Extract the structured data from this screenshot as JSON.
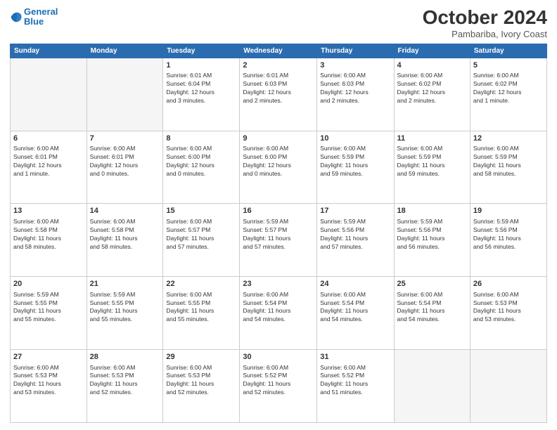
{
  "logo": {
    "line1": "General",
    "line2": "Blue"
  },
  "title": "October 2024",
  "location": "Pambariba, Ivory Coast",
  "weekdays": [
    "Sunday",
    "Monday",
    "Tuesday",
    "Wednesday",
    "Thursday",
    "Friday",
    "Saturday"
  ],
  "weeks": [
    [
      {
        "day": "",
        "info": ""
      },
      {
        "day": "",
        "info": ""
      },
      {
        "day": "1",
        "info": "Sunrise: 6:01 AM\nSunset: 6:04 PM\nDaylight: 12 hours\nand 3 minutes."
      },
      {
        "day": "2",
        "info": "Sunrise: 6:01 AM\nSunset: 6:03 PM\nDaylight: 12 hours\nand 2 minutes."
      },
      {
        "day": "3",
        "info": "Sunrise: 6:00 AM\nSunset: 6:03 PM\nDaylight: 12 hours\nand 2 minutes."
      },
      {
        "day": "4",
        "info": "Sunrise: 6:00 AM\nSunset: 6:02 PM\nDaylight: 12 hours\nand 2 minutes."
      },
      {
        "day": "5",
        "info": "Sunrise: 6:00 AM\nSunset: 6:02 PM\nDaylight: 12 hours\nand 1 minute."
      }
    ],
    [
      {
        "day": "6",
        "info": "Sunrise: 6:00 AM\nSunset: 6:01 PM\nDaylight: 12 hours\nand 1 minute."
      },
      {
        "day": "7",
        "info": "Sunrise: 6:00 AM\nSunset: 6:01 PM\nDaylight: 12 hours\nand 0 minutes."
      },
      {
        "day": "8",
        "info": "Sunrise: 6:00 AM\nSunset: 6:00 PM\nDaylight: 12 hours\nand 0 minutes."
      },
      {
        "day": "9",
        "info": "Sunrise: 6:00 AM\nSunset: 6:00 PM\nDaylight: 12 hours\nand 0 minutes."
      },
      {
        "day": "10",
        "info": "Sunrise: 6:00 AM\nSunset: 5:59 PM\nDaylight: 11 hours\nand 59 minutes."
      },
      {
        "day": "11",
        "info": "Sunrise: 6:00 AM\nSunset: 5:59 PM\nDaylight: 11 hours\nand 59 minutes."
      },
      {
        "day": "12",
        "info": "Sunrise: 6:00 AM\nSunset: 5:59 PM\nDaylight: 11 hours\nand 58 minutes."
      }
    ],
    [
      {
        "day": "13",
        "info": "Sunrise: 6:00 AM\nSunset: 5:58 PM\nDaylight: 11 hours\nand 58 minutes."
      },
      {
        "day": "14",
        "info": "Sunrise: 6:00 AM\nSunset: 5:58 PM\nDaylight: 11 hours\nand 58 minutes."
      },
      {
        "day": "15",
        "info": "Sunrise: 6:00 AM\nSunset: 5:57 PM\nDaylight: 11 hours\nand 57 minutes."
      },
      {
        "day": "16",
        "info": "Sunrise: 5:59 AM\nSunset: 5:57 PM\nDaylight: 11 hours\nand 57 minutes."
      },
      {
        "day": "17",
        "info": "Sunrise: 5:59 AM\nSunset: 5:56 PM\nDaylight: 11 hours\nand 57 minutes."
      },
      {
        "day": "18",
        "info": "Sunrise: 5:59 AM\nSunset: 5:56 PM\nDaylight: 11 hours\nand 56 minutes."
      },
      {
        "day": "19",
        "info": "Sunrise: 5:59 AM\nSunset: 5:56 PM\nDaylight: 11 hours\nand 56 minutes."
      }
    ],
    [
      {
        "day": "20",
        "info": "Sunrise: 5:59 AM\nSunset: 5:55 PM\nDaylight: 11 hours\nand 55 minutes."
      },
      {
        "day": "21",
        "info": "Sunrise: 5:59 AM\nSunset: 5:55 PM\nDaylight: 11 hours\nand 55 minutes."
      },
      {
        "day": "22",
        "info": "Sunrise: 6:00 AM\nSunset: 5:55 PM\nDaylight: 11 hours\nand 55 minutes."
      },
      {
        "day": "23",
        "info": "Sunrise: 6:00 AM\nSunset: 5:54 PM\nDaylight: 11 hours\nand 54 minutes."
      },
      {
        "day": "24",
        "info": "Sunrise: 6:00 AM\nSunset: 5:54 PM\nDaylight: 11 hours\nand 54 minutes."
      },
      {
        "day": "25",
        "info": "Sunrise: 6:00 AM\nSunset: 5:54 PM\nDaylight: 11 hours\nand 54 minutes."
      },
      {
        "day": "26",
        "info": "Sunrise: 6:00 AM\nSunset: 5:53 PM\nDaylight: 11 hours\nand 53 minutes."
      }
    ],
    [
      {
        "day": "27",
        "info": "Sunrise: 6:00 AM\nSunset: 5:53 PM\nDaylight: 11 hours\nand 53 minutes."
      },
      {
        "day": "28",
        "info": "Sunrise: 6:00 AM\nSunset: 5:53 PM\nDaylight: 11 hours\nand 52 minutes."
      },
      {
        "day": "29",
        "info": "Sunrise: 6:00 AM\nSunset: 5:53 PM\nDaylight: 11 hours\nand 52 minutes."
      },
      {
        "day": "30",
        "info": "Sunrise: 6:00 AM\nSunset: 5:52 PM\nDaylight: 11 hours\nand 52 minutes."
      },
      {
        "day": "31",
        "info": "Sunrise: 6:00 AM\nSunset: 5:52 PM\nDaylight: 11 hours\nand 51 minutes."
      },
      {
        "day": "",
        "info": ""
      },
      {
        "day": "",
        "info": ""
      }
    ]
  ]
}
